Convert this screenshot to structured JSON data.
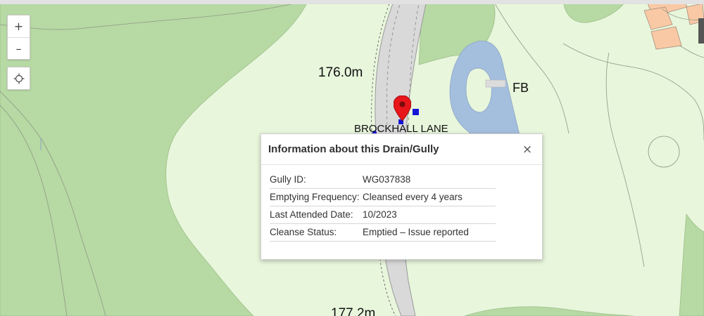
{
  "map": {
    "labels": {
      "height_top": "176.0m",
      "height_bottom": "177.2m",
      "footbridge": "FB",
      "road": "BROCKHALL LANE"
    },
    "colors": {
      "open_land": "#e8f6dc",
      "woodland": "#b7d9a3",
      "water": "#a4bede",
      "road": "#d9d9d9",
      "buildings": "#f9c9a5",
      "marker": "#e8151b",
      "asset_point": "#1515d6"
    }
  },
  "controls": {
    "zoom_in": "+",
    "zoom_out": "–",
    "locate_icon": "crosshair-icon"
  },
  "popup": {
    "title": "Information about this Drain/Gully",
    "close_label": "×",
    "rows": [
      {
        "key": "Gully ID:",
        "value": "WG037838"
      },
      {
        "key": "Emptying Frequency:",
        "value": "Cleansed every 4 years"
      },
      {
        "key": "Last Attended Date:",
        "value": "10/2023"
      },
      {
        "key": "Cleanse Status:",
        "value": "Emptied – Issue reported"
      }
    ]
  }
}
